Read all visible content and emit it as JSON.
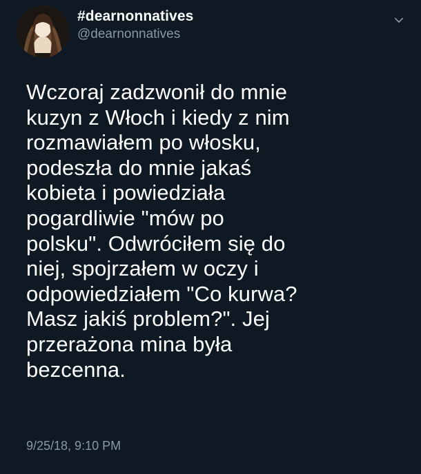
{
  "tweet": {
    "author": {
      "display_name": "#dearnonnatives",
      "handle": "@dearnonnatives",
      "avatar": "user-avatar"
    },
    "menu_icon": "chevron-down-icon",
    "text": "Wczoraj zadzwonił do mnie\nkuzyn z Włoch i kiedy z nim\nrozmawiałem po włosku,\npodeszła do mnie jakaś\nkobieta i powiedziała\npogardliwie \"mów po\npolsku\". Odwróciłem się do\nniej, spojrzałem w oczy i\nodpowiedziałem \"Co kurwa?\nMasz jakiś problem?\". Jej\nprzerażona mina była\nbezcenna.",
    "timestamp": "9/25/18, 9:10 PM"
  },
  "colors": {
    "background": "#0f1923",
    "primary_text": "#ffffff",
    "secondary_text": "#8899a6"
  }
}
